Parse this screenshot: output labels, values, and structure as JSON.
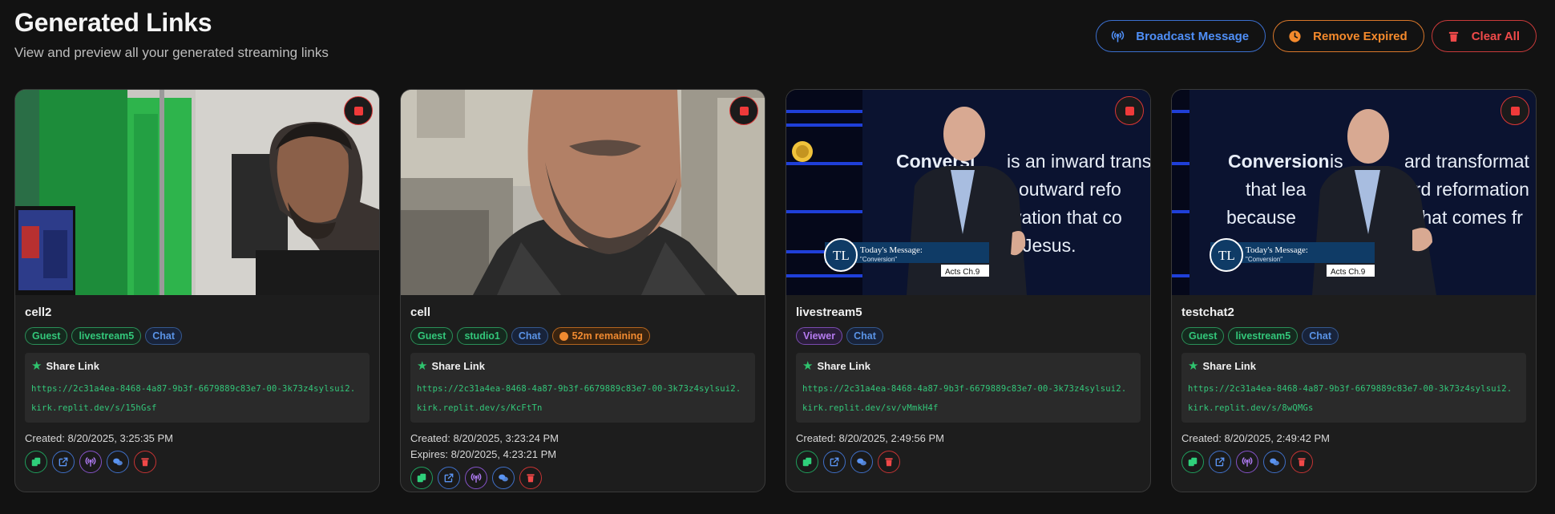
{
  "header": {
    "title": "Generated Links",
    "subtitle": "View and preview all your generated streaming links"
  },
  "actions": [
    {
      "label": "Broadcast Message",
      "icon": "broadcast-icon",
      "color": "#4f8ff7"
    },
    {
      "label": "Remove Expired",
      "icon": "clock-icon",
      "color": "#f58a2c"
    },
    {
      "label": "Clear All",
      "icon": "trash-icon",
      "color": "#f04a4a"
    }
  ],
  "share_link_label": "Share Link",
  "cards": [
    {
      "name": "cell2",
      "badges": [
        "Guest",
        "livestream5",
        "Chat"
      ],
      "url_line1": "https://2c31a4ea-8468-4a87-9b3f-6679889c83e7-00-3k73z4sylsui2.",
      "url_line2": "kirk.replit.dev/s/15hGsf",
      "created": "Created: 8/20/2025, 3:25:35 PM"
    },
    {
      "name": "cell",
      "badges": [
        "Guest",
        "studio1",
        "Chat",
        "52m remaining"
      ],
      "url_line1": "https://2c31a4ea-8468-4a87-9b3f-6679889c83e7-00-3k73z4sylsui2.",
      "url_line2": "kirk.replit.dev/s/KcFtTn",
      "created": "Created: 8/20/2025, 3:23:24 PM",
      "expires": "Expires: 8/20/2025, 4:23:21 PM"
    },
    {
      "name": "livestream5",
      "badges": [
        "Viewer",
        "Chat"
      ],
      "url_line1": "https://2c31a4ea-8468-4a87-9b3f-6679889c83e7-00-3k73z4sylsui2.",
      "url_line2": "kirk.replit.dev/sv/vMmkH4f",
      "created": "Created: 8/20/2025, 2:49:56 PM",
      "slide_line1": "Conversi",
      "slide_line1b": "is an inward trans",
      "slide_line2": "outward refo",
      "slide_line3": "vation that co",
      "slide_line4": "Jesus.",
      "lower_third_title": "Today's Message:",
      "lower_third_sub": "\"Conversion\"",
      "lower_third_ref": "Acts Ch.9",
      "logo": "TL"
    },
    {
      "name": "testchat2",
      "badges": [
        "Guest",
        "livestream5",
        "Chat"
      ],
      "url_line1": "https://2c31a4ea-8468-4a87-9b3f-6679889c83e7-00-3k73z4sylsui2.",
      "url_line2": "kirk.replit.dev/s/8wQMGs",
      "created": "Created: 8/20/2025, 2:49:42 PM",
      "slide_line1": "Conversion",
      "slide_line1b": "is",
      "slide_line1c": "ard transformat",
      "slide_line2": "that lea",
      "slide_line2b": "ard reformation",
      "slide_line3": "because",
      "slide_line3b": "that comes fr",
      "lower_third_title": "Today's Message:",
      "lower_third_sub": "\"Conversion\"",
      "lower_third_ref": "Acts Ch.9",
      "logo": "TL"
    }
  ]
}
